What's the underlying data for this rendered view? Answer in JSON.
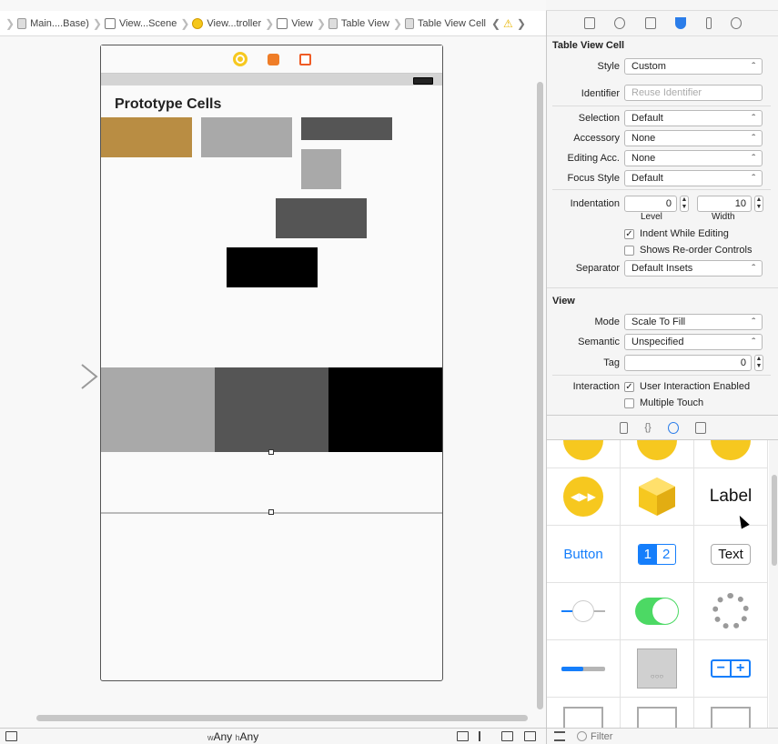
{
  "breadcrumb": [
    {
      "label": "Main....Base)",
      "icon": "storyboard-icon"
    },
    {
      "label": "View...Scene",
      "icon": "scene-icon"
    },
    {
      "label": "View...troller",
      "icon": "view-controller-icon"
    },
    {
      "label": "View",
      "icon": "view-icon"
    },
    {
      "label": "Table View",
      "icon": "table-view-icon"
    },
    {
      "label": "Table View Cell",
      "icon": "table-view-cell-icon"
    }
  ],
  "canvas": {
    "title": "Prototype Cells",
    "colors": {
      "gold": "#b98d43",
      "light_gray": "#a9a9a9",
      "dark_gray": "#555555",
      "black": "#000000"
    }
  },
  "bottom_bar": {
    "width_prefix": "w",
    "width_value": "Any",
    "height_prefix": "h",
    "height_value": "Any"
  },
  "inspector": {
    "tabs": [
      "file-inspector-icon",
      "help-icon",
      "identity-inspector-icon",
      "attributes-inspector-icon",
      "size-inspector-icon",
      "connections-inspector-icon"
    ],
    "cell_section": {
      "title": "Table View Cell",
      "style_label": "Style",
      "style_value": "Custom",
      "identifier_label": "Identifier",
      "identifier_placeholder": "Reuse Identifier",
      "selection_label": "Selection",
      "selection_value": "Default",
      "accessory_label": "Accessory",
      "accessory_value": "None",
      "editing_acc_label": "Editing Acc.",
      "editing_acc_value": "None",
      "focus_style_label": "Focus Style",
      "focus_style_value": "Default",
      "indentation_label": "Indentation",
      "level_value": "0",
      "level_label": "Level",
      "width_value": "10",
      "width_label": "Width",
      "indent_while_editing": "Indent While Editing",
      "shows_reorder": "Shows Re-order Controls",
      "separator_label": "Separator",
      "separator_value": "Default Insets"
    },
    "view_section": {
      "title": "View",
      "mode_label": "Mode",
      "mode_value": "Scale To Fill",
      "semantic_label": "Semantic",
      "semantic_value": "Unspecified",
      "tag_label": "Tag",
      "tag_value": "0",
      "interaction_label": "Interaction",
      "user_interaction": "User Interaction Enabled",
      "multiple_touch": "Multiple Touch"
    }
  },
  "library": {
    "label_text": "Label",
    "button_text": "Button",
    "segment_1": "1",
    "segment_2": "2",
    "text_field_text": "Text",
    "filter_placeholder": "Filter",
    "accent": "#157efb",
    "toggle_green": "#4cd964",
    "yellow": "#f6c81f"
  }
}
